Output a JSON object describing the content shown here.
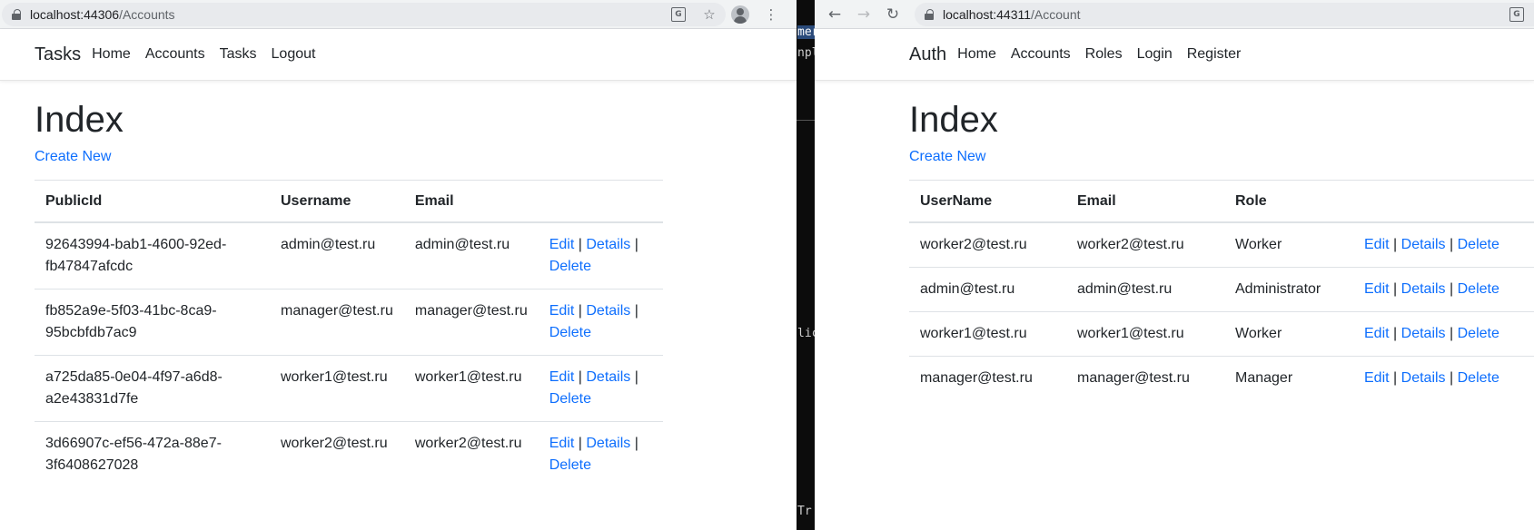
{
  "left": {
    "url_host": "localhost:44306",
    "url_path": "/Accounts",
    "brand": "Tasks",
    "nav": [
      "Home",
      "Accounts",
      "Tasks",
      "Logout"
    ],
    "title": "Index",
    "create_new": "Create New",
    "columns": [
      "PublicId",
      "Username",
      "Email"
    ],
    "rows": [
      {
        "id1": "92643994-bab1-4600-92ed-",
        "id2": "fb47847afcdc",
        "username": "admin@test.ru",
        "email": "admin@test.ru"
      },
      {
        "id1": "fb852a9e-5f03-41bc-8ca9-",
        "id2": "95bcbfdb7ac9",
        "username": "manager@test.ru",
        "email": "manager@test.ru"
      },
      {
        "id1": "a725da85-0e04-4f97-a6d8-",
        "id2": "a2e43831d7fe",
        "username": "worker1@test.ru",
        "email": "worker1@test.ru"
      },
      {
        "id1": "3d66907c-ef56-472a-88e7-",
        "id2": "3f6408627028",
        "username": "worker2@test.ru",
        "email": "worker2@test.ru"
      }
    ]
  },
  "right": {
    "url_host": "localhost:44311",
    "url_path": "/Account",
    "brand": "Auth",
    "nav": [
      "Home",
      "Accounts",
      "Roles",
      "Login",
      "Register"
    ],
    "title": "Index",
    "create_new": "Create New",
    "columns": [
      "UserName",
      "Email",
      "Role"
    ],
    "rows": [
      {
        "username": "worker2@test.ru",
        "email": "worker2@test.ru",
        "role": "Worker"
      },
      {
        "username": "admin@test.ru",
        "email": "admin@test.ru",
        "role": "Administrator"
      },
      {
        "username": "worker1@test.ru",
        "email": "worker1@test.ru",
        "role": "Worker"
      },
      {
        "username": "manager@test.ru",
        "email": "manager@test.ru",
        "role": "Manager"
      }
    ]
  },
  "actions": {
    "edit": "Edit",
    "details": "Details",
    "delete": "Delete",
    "sep": "|"
  },
  "terminal": {
    "t1": "mer",
    "t2": "nple",
    "t3": "lic",
    "t4": "Tr"
  },
  "icons": {
    "translate_glyph": "G"
  },
  "colors": {
    "link": "#0d6efd",
    "text": "#212529",
    "border": "#dee2e6",
    "chrome_bar": "#f1f3f4",
    "terminal_bg": "#0c0c0c"
  }
}
